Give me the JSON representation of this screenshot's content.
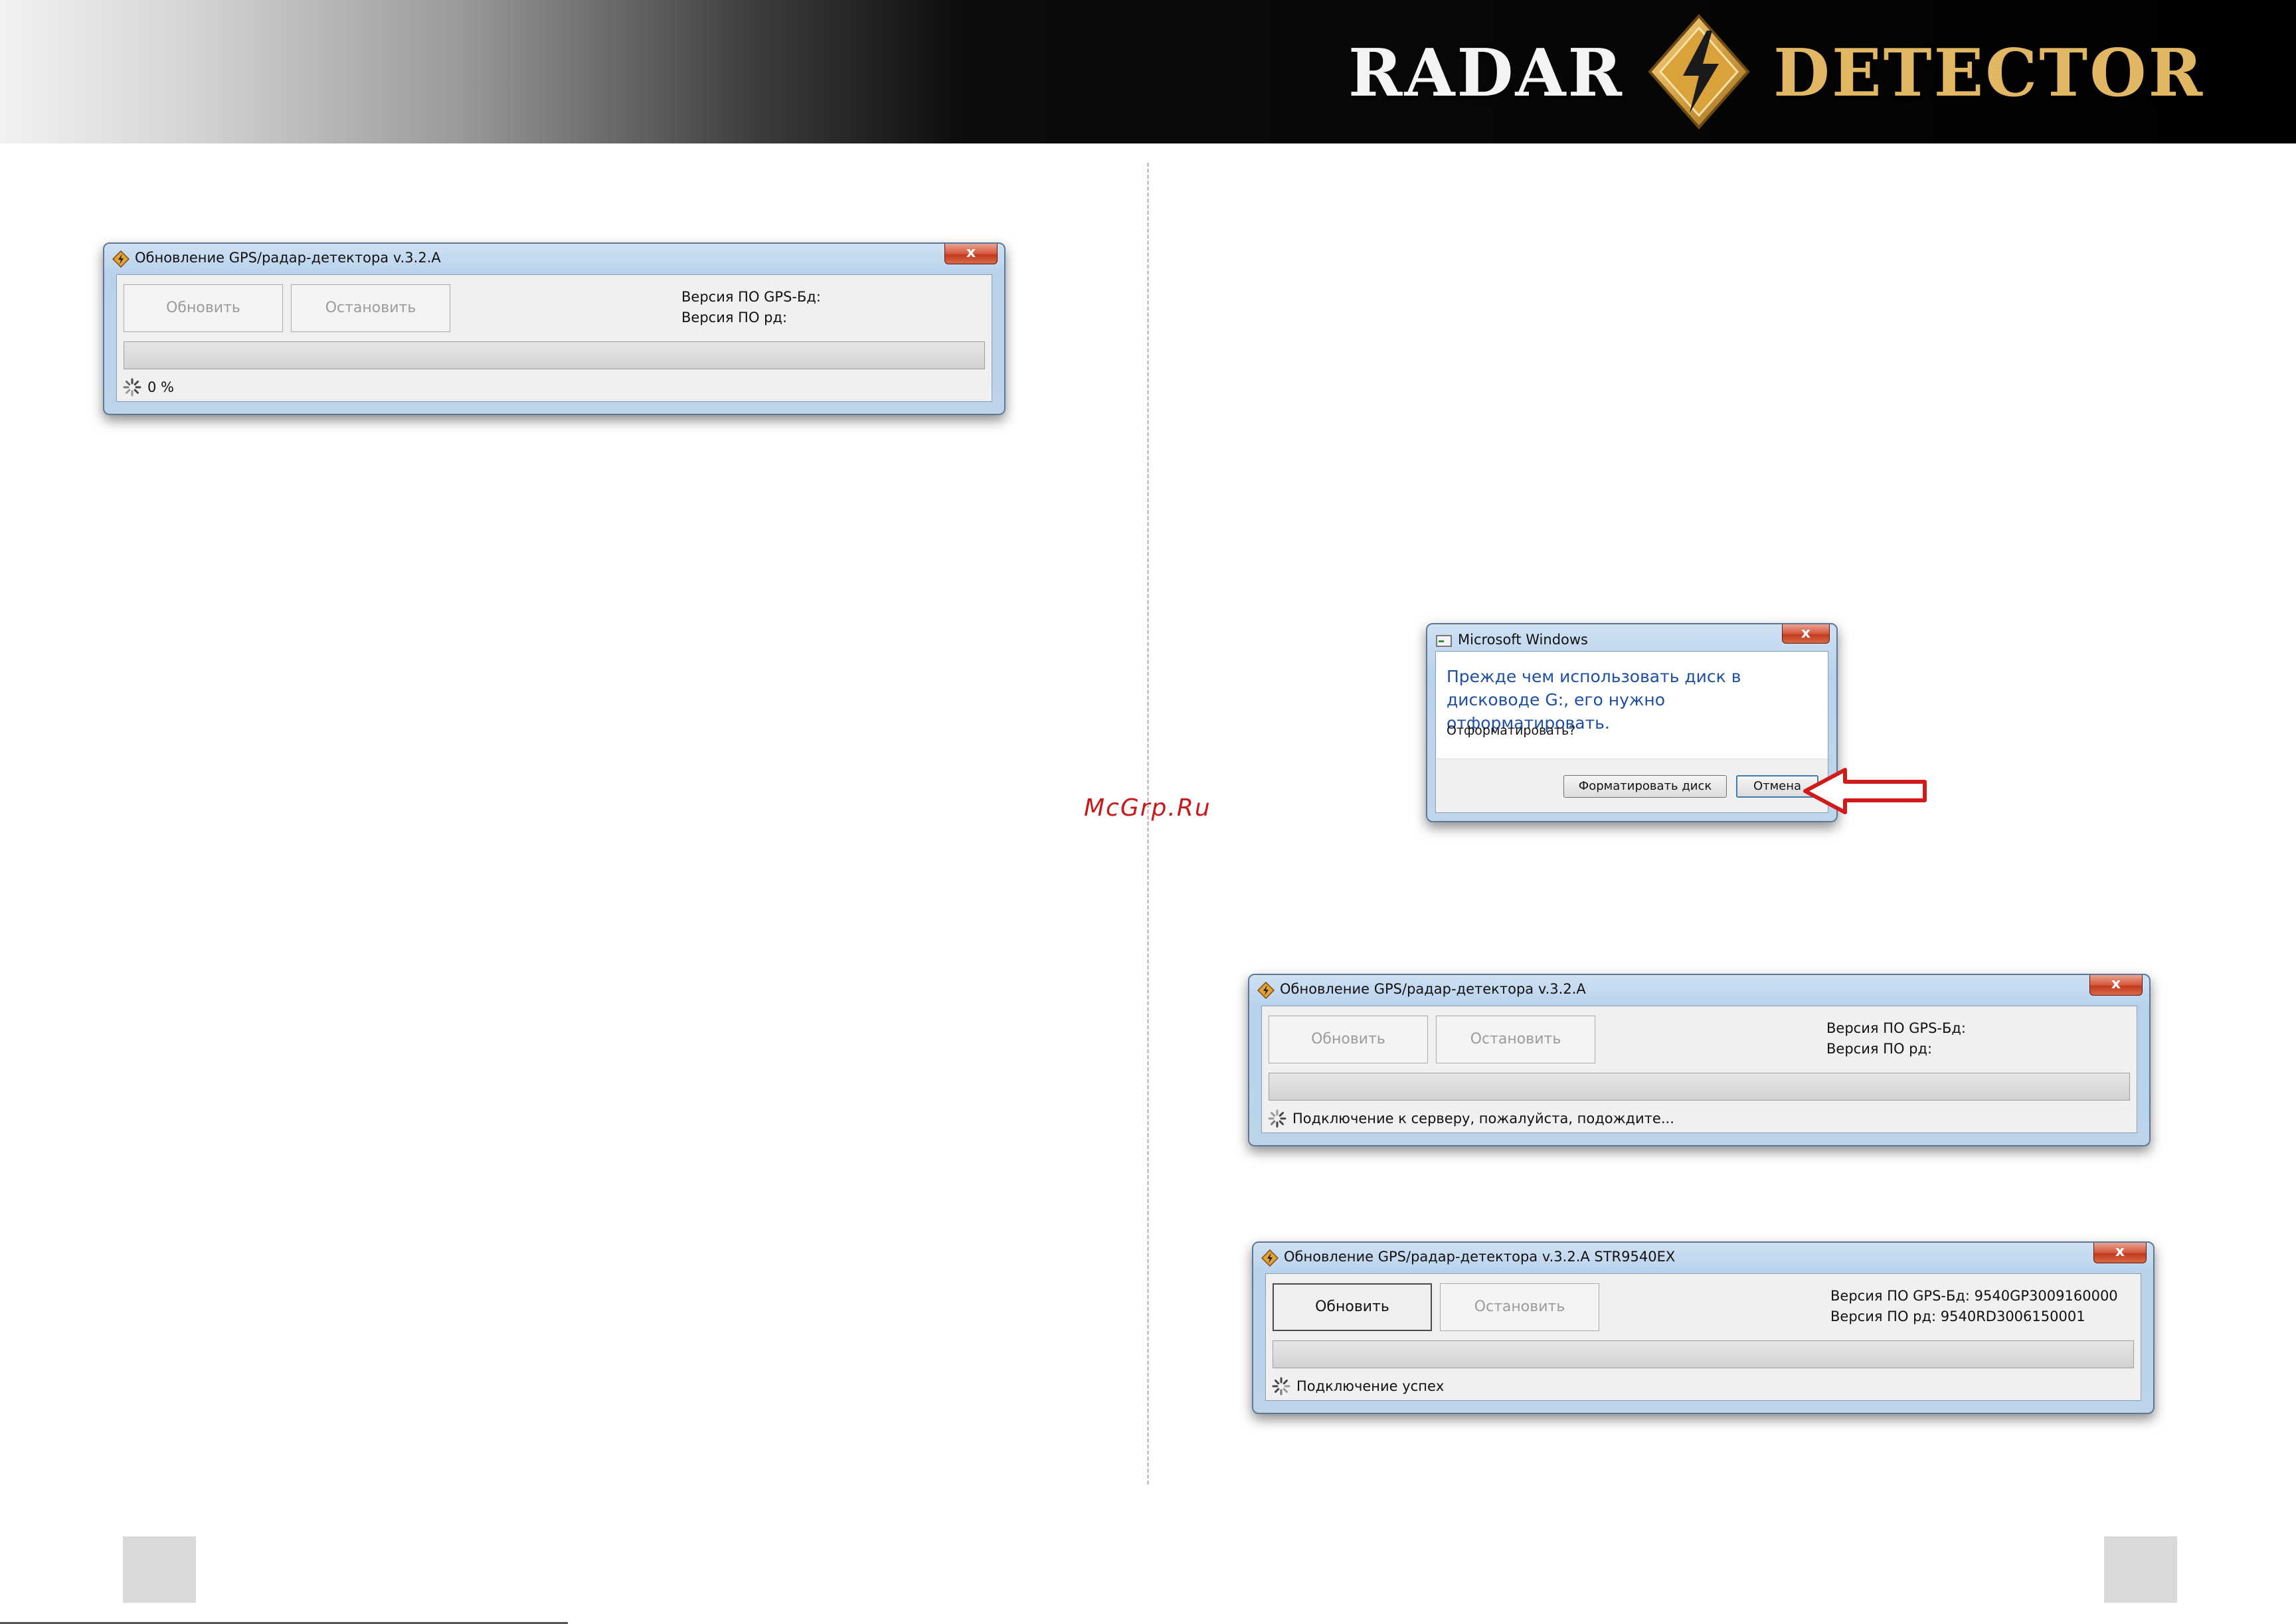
{
  "header": {
    "logo_word_1": "RADAR",
    "logo_word_2": "DETECTOR",
    "logo_icon": "lightning-bolt-diamond-icon"
  },
  "watermark": "McGrp.Ru",
  "colors": {
    "window_border": "#5e7794",
    "window_title_gradient": "#cfe1f3",
    "close_button": "#c33a1d",
    "dialog_text": "#1f4fa3",
    "arrow": "#d11a1a",
    "logo_gold": "#e2b763"
  },
  "windows": [
    {
      "title": "Обновление GPS/радар-детектора   v.3.2.A",
      "close_label": "x",
      "update_label": "Обновить",
      "update_enabled": false,
      "stop_label": "Остановить",
      "stop_enabled": false,
      "version_gps_db": "Версия ПО GPS-Бд:",
      "version_rd": "Версия ПО рд:",
      "progress": 0,
      "status": "0 %"
    },
    {
      "title": "Обновление GPS/радар-детектора   v.3.2.A",
      "close_label": "x",
      "update_label": "Обновить",
      "update_enabled": false,
      "stop_label": "Остановить",
      "stop_enabled": false,
      "version_gps_db": "Версия ПО GPS-Бд:",
      "version_rd": "Версия ПО рд:",
      "progress": 0,
      "status": "Подключение к серверу, пожалуйста, подождите..."
    },
    {
      "title": "Обновление GPS/радар-детектора   v.3.2.A     STR9540EX",
      "close_label": "x",
      "update_label": "Обновить",
      "update_enabled": true,
      "stop_label": "Остановить",
      "stop_enabled": false,
      "version_gps_db": "Версия ПО GPS-Бд:   9540GP3009160000",
      "version_rd": "Версия ПО рд:   9540RD3006150001",
      "progress": 0,
      "status": "Подключение успех"
    }
  ],
  "dialog": {
    "title": "Microsoft Windows",
    "close_label": "x",
    "message": "Прежде чем использовать диск в дисководе G:, его нужно отформатировать.",
    "question": "Отформатировать?",
    "format_button": "Форматировать диск",
    "cancel_button": "Отмена"
  }
}
